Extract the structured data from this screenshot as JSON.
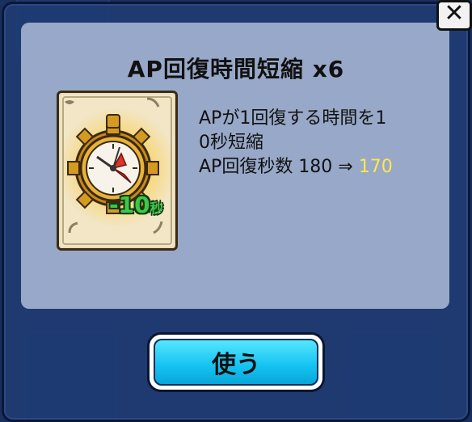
{
  "dialog": {
    "title": "AP回復時間短縮 x6",
    "description_line1": "APが1回復する時間を1",
    "description_line2": "0秒短縮",
    "ap_label": "AP回復秒数 180 ⇒ ",
    "ap_new_value": "170",
    "close_label": "✕",
    "use_button_label": "使う"
  },
  "card": {
    "icon": "stopwatch-gear-icon",
    "badge_text": "-10",
    "badge_unit": "秒"
  },
  "colors": {
    "highlight": "#ffe84a",
    "button": "#13c2f0",
    "panel": "#98a8c8"
  }
}
